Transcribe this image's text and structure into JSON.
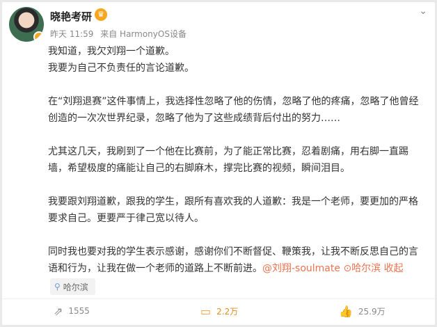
{
  "post": {
    "author": "晓艳考研",
    "time": "昨天 11:59",
    "source": "来自 HarmonyOS设备",
    "lines": [
      "我知道，我欠刘翔一个道歉。",
      "我要为自己不负责任的言论道歉。",
      "",
      "在“刘翔退赛”这件事情上，我选择性忽略了他的伤情，忽略了他的疼痛，忽略了他曾经",
      "创造的一次次世界纪录，忽略了他为了这些成绩背后付出的努力……",
      "",
      "尤其这几天，我刷到了一个他在比赛前，为了能正常比赛，忍着剧痛，用右脚一直踢",
      "墙，希望极度的痛能让自己的右脚麻木，撑完比赛的视频，瞬间泪目。",
      "",
      "我要跟刘翔道歉，跟我的学生，跟所有喜欢我的人道歉：我是一个老师，要更加的严格",
      "要求自己。更要严于律己宽以待人。",
      "",
      "同时我也要对我的学生表示感谢，感谢你们不断督促、鞭策我，让我不断反思自己的言"
    ],
    "last_line_text": "语和行为，让我在做一个老师的道路上不断前进。",
    "mention": "@刘翔-soulmate",
    "location_link": "哈尔滨",
    "collapse": "收起",
    "location_chip": "哈尔滨"
  },
  "actions": {
    "repost_count": "1555",
    "comment_count": "2.2万",
    "like_count": "25.9万"
  },
  "colors": {
    "link": "#eb7350",
    "accent": "#f5a623"
  }
}
